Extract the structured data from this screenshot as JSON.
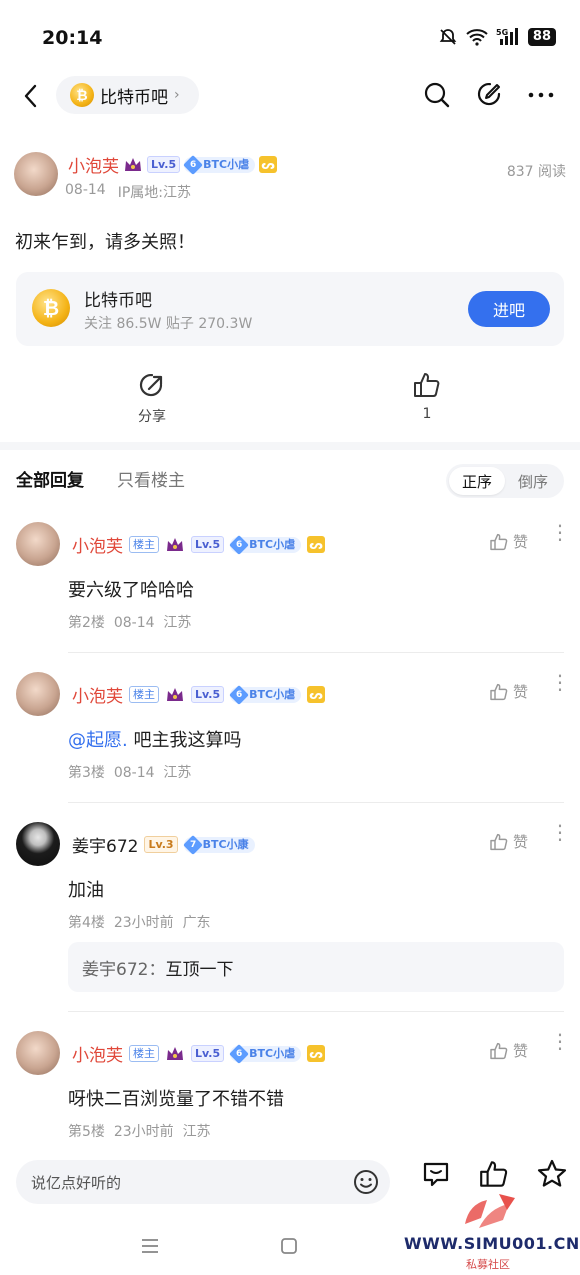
{
  "status": {
    "time": "20:14",
    "battery": "88",
    "network": "5G"
  },
  "nav": {
    "forum_name": "比特币吧",
    "coin_glyph": "₿"
  },
  "post": {
    "author": "小泡芙",
    "level": "Lv.5",
    "tag_num": "6",
    "tag_label": "BTC小虐",
    "yellow_badge": "ᔕ",
    "date": "08-14",
    "ip": "IP属地:江苏",
    "reads": "837 阅读",
    "content": "初来乍到，请多关照！"
  },
  "forum_card": {
    "name": "比特币吧",
    "stats": "关注 86.5W  贴子 270.3W",
    "join_label": "进吧"
  },
  "actions": {
    "share_label": "分享",
    "like_count": "1"
  },
  "tabs": {
    "all": "全部回复",
    "owner_only": "只看楼主",
    "sort_asc": "正序",
    "sort_desc": "倒序"
  },
  "comments": [
    {
      "name": "小泡芙",
      "owner_tag": "楼主",
      "level": "Lv.5",
      "tag_num": "6",
      "tag_label": "BTC小虐",
      "like": "赞",
      "text": "要六级了哈哈哈",
      "floor": "第2楼",
      "time": "08-14",
      "loc": "江苏"
    },
    {
      "name": "小泡芙",
      "owner_tag": "楼主",
      "level": "Lv.5",
      "tag_num": "6",
      "tag_label": "BTC小虐",
      "like": "赞",
      "mention": "@起愿.",
      "text": "吧主我这算吗",
      "floor": "第3楼",
      "time": "08-14",
      "loc": "江苏"
    },
    {
      "name": "姜宇672",
      "level": "Lv.3",
      "tag_num": "7",
      "tag_label": "BTC小康",
      "like": "赞",
      "text": "加油",
      "floor": "第4楼",
      "time": "23小时前",
      "loc": "广东",
      "reply_name": "姜宇672：",
      "reply_text": "互顶一下"
    },
    {
      "name": "小泡芙",
      "owner_tag": "楼主",
      "level": "Lv.5",
      "tag_num": "6",
      "tag_label": "BTC小虐",
      "like": "赞",
      "text": "呀快二百浏览量了不错不错",
      "floor": "第5楼",
      "time": "23小时前",
      "loc": "江苏"
    }
  ],
  "bottom": {
    "placeholder": "说亿点好听的"
  },
  "watermark": {
    "site": "WWW.SIMU001.CN",
    "sub": "私募社区"
  },
  "colors": {
    "accent": "#3470ee",
    "username_red": "#e0483a"
  }
}
